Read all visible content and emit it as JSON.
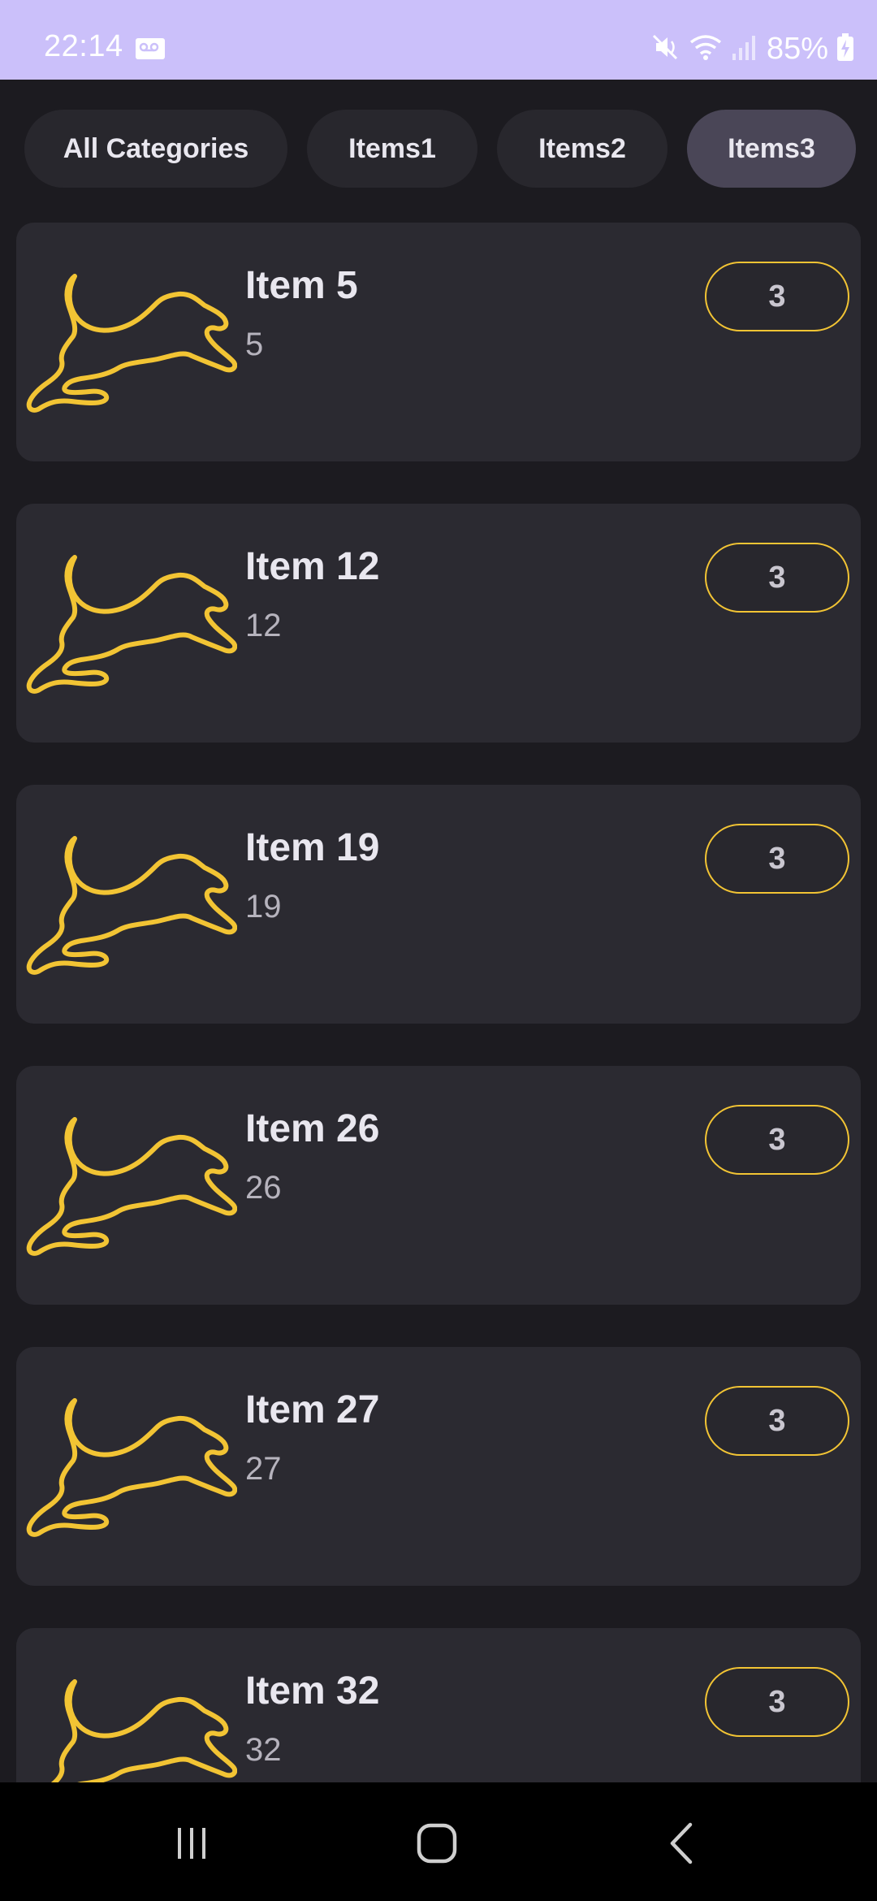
{
  "status_bar": {
    "time": "22:14",
    "battery": "85%",
    "icons": [
      "voicemail-icon",
      "mute-icon",
      "wifi-icon",
      "signal-icon",
      "battery-charging-icon"
    ]
  },
  "tabs": [
    {
      "label": "All Categories",
      "active": false
    },
    {
      "label": "Items1",
      "active": false
    },
    {
      "label": "Items2",
      "active": false
    },
    {
      "label": "Items3",
      "active": true
    }
  ],
  "items": [
    {
      "title": "Item 5",
      "subtitle": "5",
      "quantity": "3",
      "icon": "running-dog-icon"
    },
    {
      "title": "Item 12",
      "subtitle": "12",
      "quantity": "3",
      "icon": "running-dog-icon"
    },
    {
      "title": "Item 19",
      "subtitle": "19",
      "quantity": "3",
      "icon": "running-dog-icon"
    },
    {
      "title": "Item 26",
      "subtitle": "26",
      "quantity": "3",
      "icon": "running-dog-icon"
    },
    {
      "title": "Item 27",
      "subtitle": "27",
      "quantity": "3",
      "icon": "running-dog-icon"
    },
    {
      "title": "Item 32",
      "subtitle": "32",
      "quantity": "3",
      "icon": "running-dog-icon"
    }
  ],
  "navigation": {
    "buttons": [
      "recent-apps-icon",
      "home-icon",
      "back-icon"
    ]
  },
  "colors": {
    "status_bar": "#cbc0fa",
    "background": "#1c1b20",
    "card": "#2b2a31",
    "accent": "#f2c434",
    "active_tab": "#4a4657"
  }
}
